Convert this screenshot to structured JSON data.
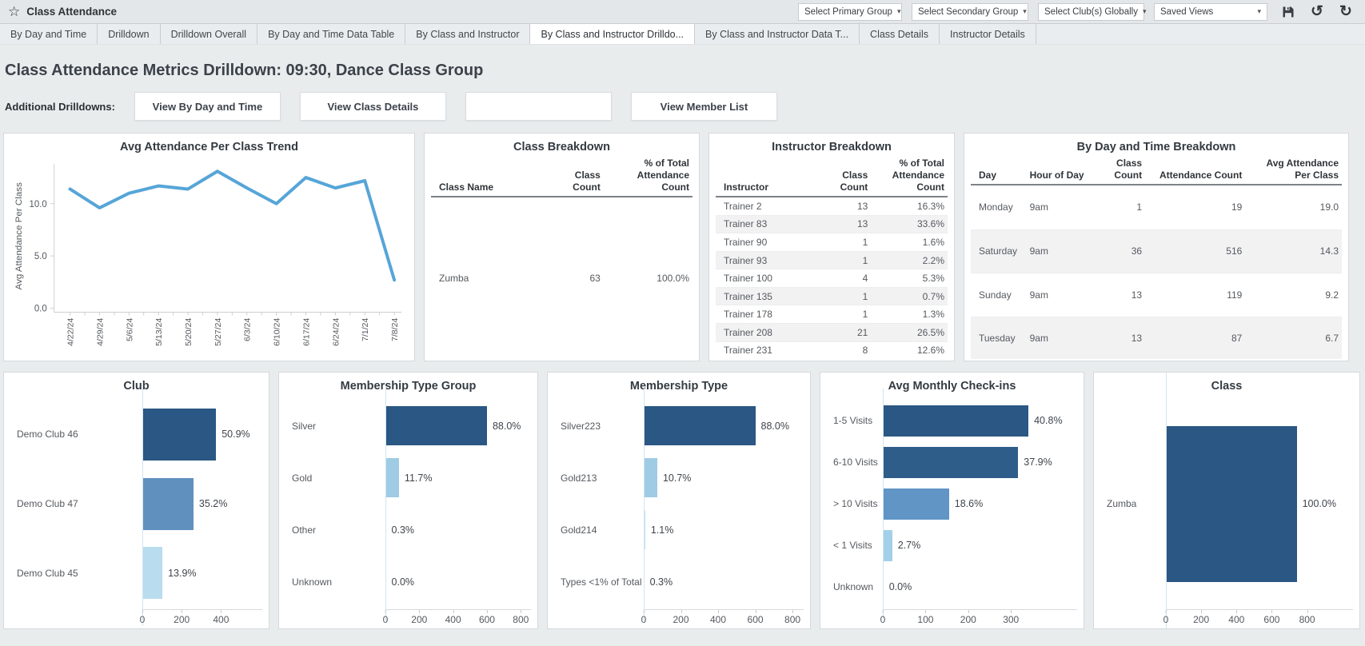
{
  "titlebar": {
    "app_title": "Class Attendance",
    "selects": [
      {
        "label": "Select Primary Group"
      },
      {
        "label": "Select Secondary Group"
      },
      {
        "label": "Select Club(s) Globally"
      },
      {
        "label": "Saved Views"
      }
    ],
    "icons": [
      "save-icon",
      "undo-icon",
      "refresh-icon"
    ]
  },
  "tabs": [
    {
      "label": "By Day and Time",
      "active": false
    },
    {
      "label": "Drilldown",
      "active": false
    },
    {
      "label": "Drilldown Overall",
      "active": false
    },
    {
      "label": "By Day and Time Data Table",
      "active": false
    },
    {
      "label": "By Class and Instructor",
      "active": false
    },
    {
      "label": "By Class and Instructor Drilldo...",
      "active": true
    },
    {
      "label": "By Class and Instructor Data T...",
      "active": false
    },
    {
      "label": "Class Details",
      "active": false
    },
    {
      "label": "Instructor Details",
      "active": false
    }
  ],
  "page": {
    "title": "Class Attendance Metrics Drilldown: 09:30, Dance Class Group",
    "drilldowns_label": "Additional Drilldowns:",
    "drilldown_buttons": [
      "View By Day and Time",
      "View Class Details",
      "",
      "View Member List"
    ]
  },
  "colors": {
    "accent_line": "#56a5d8",
    "bar_dark": "#2a5783",
    "bar_medium": "#6090be",
    "bar_light": "#9fcbe4",
    "bar_pale": "#cfe9f6"
  },
  "chart_data": [
    {
      "id": "trend",
      "type": "line",
      "title": "Avg Attendance Per Class Trend",
      "ylabel": "Avg Attendance Per Class",
      "x": [
        "4/22/24",
        "4/29/24",
        "5/6/24",
        "5/13/24",
        "5/20/24",
        "5/27/24",
        "6/3/24",
        "6/10/24",
        "6/17/24",
        "6/24/24",
        "7/1/24",
        "7/8/24"
      ],
      "values": [
        11.4,
        9.6,
        11.0,
        11.7,
        11.4,
        13.1,
        11.5,
        10.0,
        12.5,
        11.5,
        12.2,
        2.7
      ],
      "yticks": [
        "0.0",
        "5.0",
        "10.0"
      ],
      "ylim": [
        0,
        13.8
      ],
      "line_color": "#56a5d8",
      "grid": false
    },
    {
      "id": "class_breakdown",
      "type": "table",
      "title": "Class Breakdown",
      "columns": [
        "Class Name",
        "Class Count",
        "% of Total Attendance Count"
      ],
      "aligns": [
        "left",
        "right",
        "right"
      ],
      "col_widths": [
        "44%",
        "22%",
        "34%"
      ],
      "rows": [
        [
          "Zumba",
          "63",
          "100.0%"
        ]
      ]
    },
    {
      "id": "instructor_breakdown",
      "type": "table",
      "title": "Instructor Breakdown",
      "columns": [
        "Instructor",
        "Class Count",
        "% of Total Attendance Count"
      ],
      "aligns": [
        "left",
        "right",
        "right"
      ],
      "col_widths": [
        "45%",
        "22%",
        "33%"
      ],
      "rows": [
        [
          "Trainer 2",
          "13",
          "16.3%"
        ],
        [
          "Trainer 83",
          "13",
          "33.6%"
        ],
        [
          "Trainer 90",
          "1",
          "1.6%"
        ],
        [
          "Trainer 93",
          "1",
          "2.2%"
        ],
        [
          "Trainer 100",
          "4",
          "5.3%"
        ],
        [
          "Trainer 135",
          "1",
          "0.7%"
        ],
        [
          "Trainer 178",
          "1",
          "1.3%"
        ],
        [
          "Trainer 208",
          "21",
          "26.5%"
        ],
        [
          "Trainer 231",
          "8",
          "12.6%"
        ]
      ]
    },
    {
      "id": "day_time_breakdown",
      "type": "table",
      "title": "By Day and Time Breakdown",
      "columns": [
        "Day",
        "Hour of Day",
        "Class Count",
        "Attendance Count",
        "Avg Attendance Per Class"
      ],
      "aligns": [
        "left",
        "left",
        "right",
        "right",
        "right"
      ],
      "col_widths": [
        "15%",
        "19%",
        "13%",
        "27%",
        "26%"
      ],
      "rows": [
        [
          "Monday",
          "9am",
          "1",
          "19",
          "19.0"
        ],
        [
          "Saturday",
          "9am",
          "36",
          "516",
          "14.3"
        ],
        [
          "Sunday",
          "9am",
          "13",
          "119",
          "9.2"
        ],
        [
          "Tuesday",
          "9am",
          "13",
          "87",
          "6.7"
        ]
      ]
    },
    {
      "id": "club",
      "type": "bar",
      "title": "Club",
      "categories": [
        "Demo Club 46",
        "Demo Club 47",
        "Demo Club 45"
      ],
      "values": [
        375,
        260,
        102
      ],
      "labels": [
        "50.9%",
        "35.2%",
        "13.9%"
      ],
      "colors": [
        "#2a5783",
        "#6090be",
        "#b9dcef"
      ],
      "xticks": [
        0,
        200,
        400
      ],
      "xmax": 610,
      "label_width": 165
    },
    {
      "id": "membership_type_group",
      "type": "bar",
      "title": "Membership Type Group",
      "categories": [
        "Silver",
        "Gold",
        "Other",
        "Unknown"
      ],
      "values": [
        600,
        80,
        2,
        0
      ],
      "labels": [
        "88.0%",
        "11.7%",
        "0.3%",
        "0.0%"
      ],
      "colors": [
        "#2a5783",
        "#9fcbe4",
        "#cfe9f6",
        "#cfe9f6"
      ],
      "xticks": [
        0,
        200,
        400,
        600,
        800
      ],
      "xmax": 860,
      "label_width": 125
    },
    {
      "id": "membership_type",
      "type": "bar",
      "title": "Membership Type",
      "categories": [
        "Silver223",
        "Gold213",
        "Gold214",
        "Types <1% of Total"
      ],
      "values": [
        600,
        73,
        8,
        2
      ],
      "labels": [
        "88.0%",
        "10.7%",
        "1.1%",
        "0.3%"
      ],
      "colors": [
        "#2a5783",
        "#9fcbe4",
        "#bfe2f2",
        "#cfe9f6"
      ],
      "xticks": [
        0,
        200,
        400,
        600,
        800
      ],
      "xmax": 860,
      "label_width": 112
    },
    {
      "id": "avg_monthly_checkins",
      "type": "bar",
      "title": "Avg Monthly Check-ins",
      "categories": [
        "1-5 Visits",
        "6-10 Visits",
        "> 10 Visits",
        "< 1 Visits",
        "Unknown"
      ],
      "values": [
        341,
        317,
        155,
        22,
        0
      ],
      "labels": [
        "40.8%",
        "37.9%",
        "18.6%",
        "2.7%",
        "0.0%"
      ],
      "colors": [
        "#2a5783",
        "#2f5d89",
        "#6095c5",
        "#a3d0e8",
        "#cfe9f6"
      ],
      "xticks": [
        0,
        100,
        200,
        300
      ],
      "xmax": 455,
      "label_width": 70
    },
    {
      "id": "class",
      "type": "bar",
      "title": "Class",
      "categories": [
        "Zumba"
      ],
      "values": [
        741
      ],
      "labels": [
        "100.0%"
      ],
      "colors": [
        "#2a5783"
      ],
      "xticks": [
        0,
        200,
        400,
        600,
        800
      ],
      "xmax": 1060,
      "label_width": 82
    }
  ]
}
